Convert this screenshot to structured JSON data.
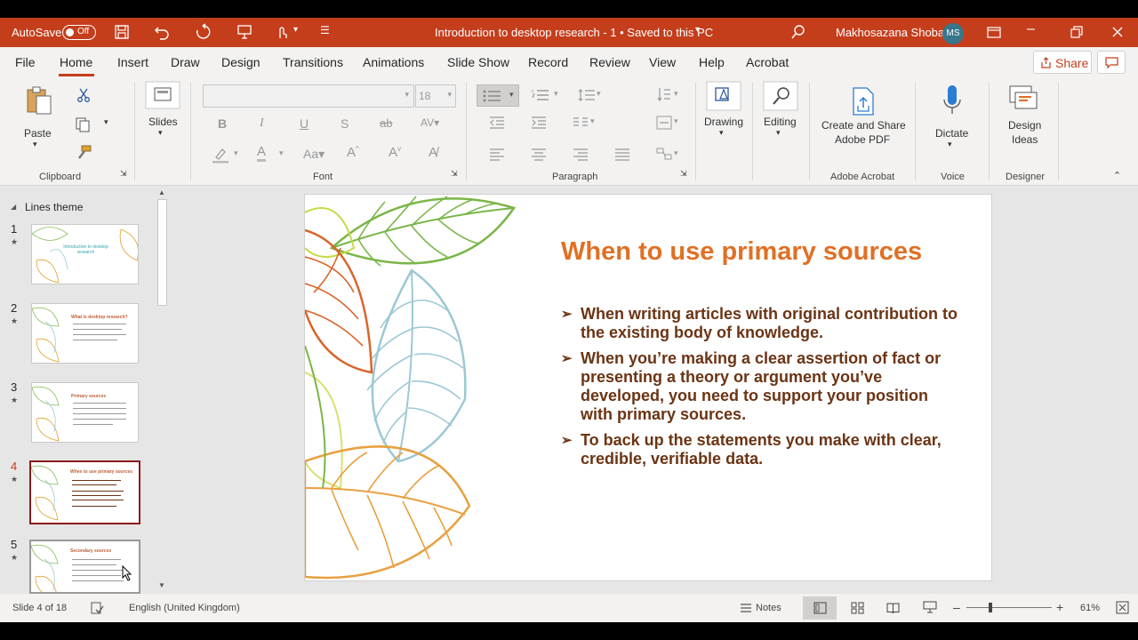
{
  "titlebar": {
    "autosave_label": "AutoSave",
    "autosave_state": "Off",
    "doc_title": "Introduction to desktop research - 1 • Saved to this PC",
    "user_name": "Makhosazana Shoba",
    "user_initials": "MS",
    "accent_color": "#c43e1c"
  },
  "menu": {
    "items": [
      "File",
      "Home",
      "Insert",
      "Draw",
      "Design",
      "Transitions",
      "Animations",
      "Slide Show",
      "Record",
      "Review",
      "View",
      "Help",
      "Acrobat"
    ],
    "active": "Home",
    "share_label": "Share"
  },
  "ribbon": {
    "clipboard": {
      "paste": "Paste",
      "label": "Clipboard"
    },
    "slides": {
      "new_slide": "Slides"
    },
    "font": {
      "size": "18",
      "label": "Font"
    },
    "paragraph": {
      "label": "Paragraph"
    },
    "drawing": {
      "label": "Drawing"
    },
    "editing": {
      "label": "Editing"
    },
    "acrobat": {
      "create_line1": "Create and Share",
      "create_line2": "Adobe PDF",
      "label": "Adobe Acrobat"
    },
    "voice": {
      "dictate": "Dictate",
      "label": "Voice"
    },
    "designer": {
      "line1": "Design",
      "line2": "Ideas",
      "label": "Designer"
    }
  },
  "panel": {
    "theme_label": "Lines theme",
    "thumbs": [
      {
        "num": "1",
        "title": "Introduction to desktop research"
      },
      {
        "num": "2",
        "title": "What is desktop research?"
      },
      {
        "num": "3",
        "title": "Primary sources"
      },
      {
        "num": "4",
        "title": "When to use primary sources"
      },
      {
        "num": "5",
        "title": "Secondary sources"
      }
    ],
    "selected": "4"
  },
  "slide": {
    "title": "When to use primary sources",
    "bullets": [
      "When writing articles with original contribution to the existing body of knowledge.",
      "When you’re making a clear assertion of fact or presenting a theory or argument you’ve developed, you need to support your position with primary sources.",
      "To back up the statements you make with clear, credible, verifiable data."
    ],
    "title_color": "#e07024",
    "text_color": "#6b3414"
  },
  "status": {
    "slide_info": "Slide 4 of 18",
    "language": "English (United Kingdom)",
    "notes": "Notes",
    "zoom": "61%"
  }
}
